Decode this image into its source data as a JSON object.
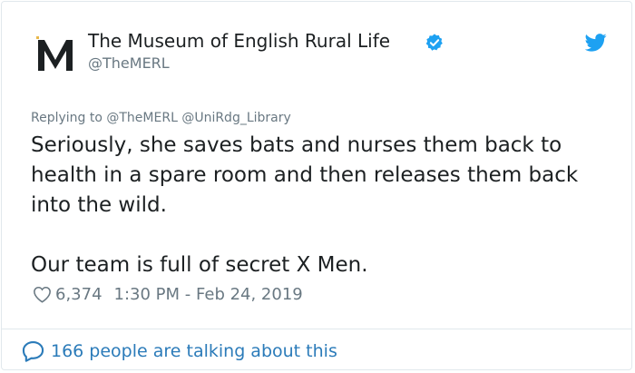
{
  "author": {
    "name": "The Museum of English Rural Life",
    "handle": "@TheMERL",
    "verified_icon": "verified-badge-icon",
    "logo_icon": "merl-logo-icon"
  },
  "platform_icon": "twitter-bird-icon",
  "reply_to": "Replying to @TheMERL @UniRdg_Library",
  "tweet": {
    "paragraphs": [
      "Seriously, she saves bats and nurses them back to health in a spare room and then releases them back into the wild.",
      "Our team is full of secret X Men."
    ]
  },
  "meta": {
    "likes": "6,374",
    "timestamp": "1:30 PM - Feb 24, 2019"
  },
  "footer": {
    "conversation_text": "166 people are talking about this"
  },
  "colors": {
    "accent": "#1da1f2",
    "link": "#2b7bb9",
    "secondary_text": "#697882",
    "text": "#1c2022",
    "border": "#e1e8ed"
  }
}
